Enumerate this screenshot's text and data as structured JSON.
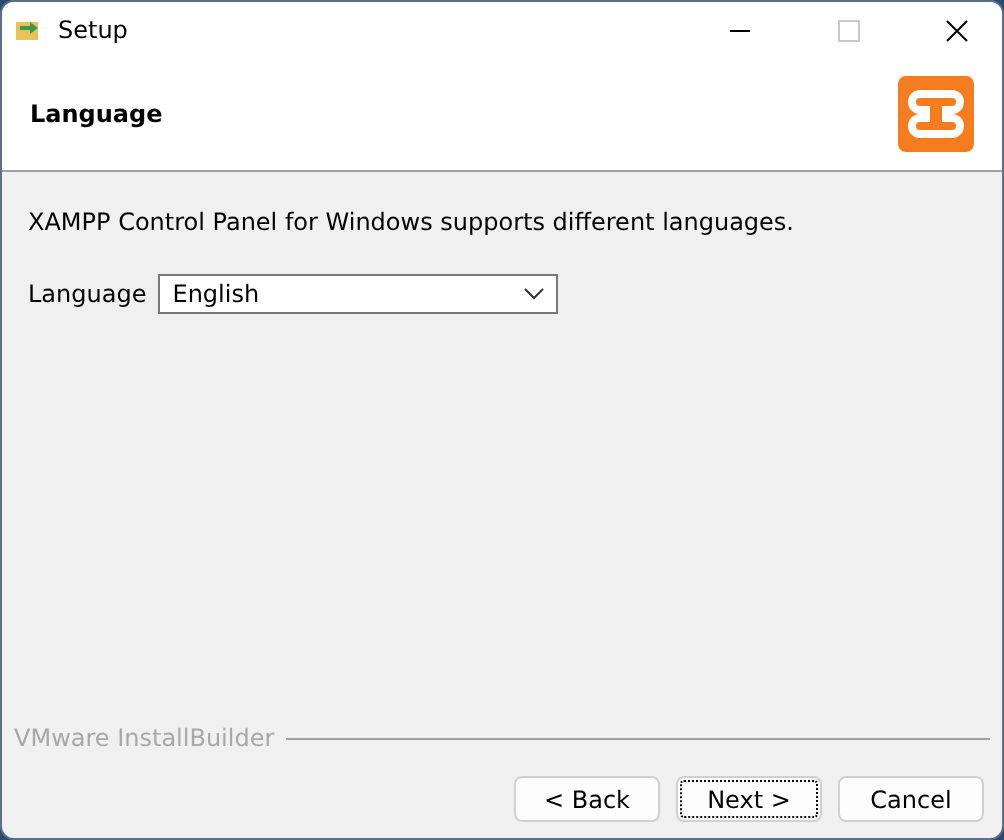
{
  "window": {
    "title": "Setup"
  },
  "header": {
    "title": "Language"
  },
  "description": "XAMPP Control Panel for Windows supports different languages.",
  "language": {
    "label": "Language",
    "value": "English"
  },
  "footer": {
    "brand": "VMware InstallBuilder"
  },
  "buttons": [
    {
      "label": "< Back",
      "focused": false
    },
    {
      "label": "Next >",
      "focused": true
    },
    {
      "label": "Cancel",
      "focused": false
    }
  ]
}
